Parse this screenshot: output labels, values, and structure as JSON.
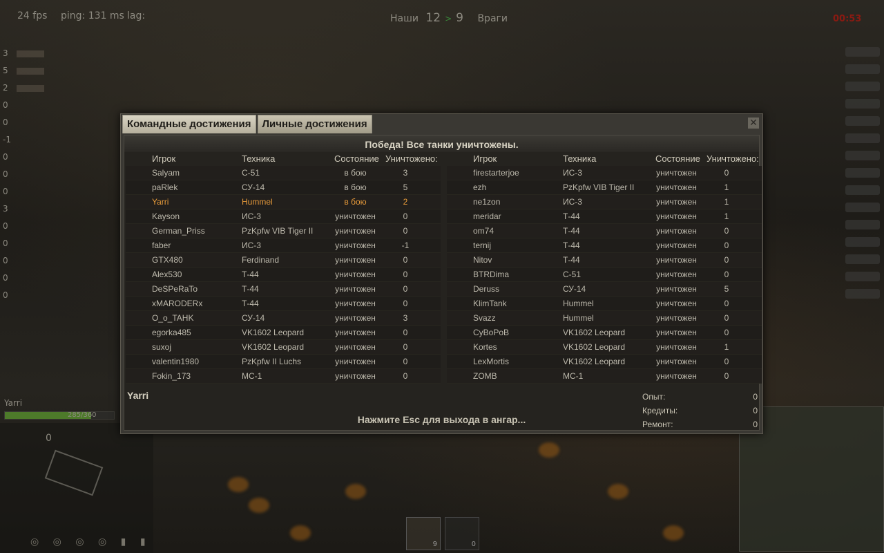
{
  "hud": {
    "fps": "24 fps",
    "ping": "ping: 131 ms",
    "lag": "lag:",
    "allies_label": "Наши",
    "allies_score": "12",
    "score_arrow": ">",
    "enemies_score": "9",
    "enemies_label": "Враги",
    "timer": "00:53",
    "left_frags": [
      "3",
      "5",
      "2",
      "0",
      "0",
      "-1",
      "0",
      "0",
      "0",
      "3",
      "0",
      "0",
      "0",
      "0",
      "0"
    ],
    "player_name": "Yarri",
    "hp_text": "285/360",
    "hp_fraction": 0.79,
    "speed": "0"
  },
  "dialog": {
    "tabs": [
      {
        "label": "Командные достижения",
        "active": true
      },
      {
        "label": "Личные достижения",
        "active": false
      }
    ],
    "close_icon": "close-icon",
    "result_text": "Победа! Все танки уничтожены.",
    "columns": {
      "player": "Игрок",
      "tank": "Техника",
      "status": "Состояние",
      "kills": "Уничтожено:"
    },
    "allies": [
      {
        "name": "Salyam",
        "tank": "С-51",
        "status": "в бою",
        "kills": "3"
      },
      {
        "name": "paRlek",
        "tank": "СУ-14",
        "status": "в бою",
        "kills": "5"
      },
      {
        "name": "Yarri",
        "tank": "Hummel",
        "status": "в бою",
        "kills": "2",
        "self": true
      },
      {
        "name": "Kayson",
        "tank": "ИС-3",
        "status": "уничтожен",
        "kills": "0"
      },
      {
        "name": "German_Priss",
        "tank": "PzKpfw VIB Tiger II",
        "status": "уничтожен",
        "kills": "0"
      },
      {
        "name": "faber",
        "tank": "ИС-3",
        "status": "уничтожен",
        "kills": "-1"
      },
      {
        "name": "GTX480",
        "tank": "Ferdinand",
        "status": "уничтожен",
        "kills": "0"
      },
      {
        "name": "Alex530",
        "tank": "Т-44",
        "status": "уничтожен",
        "kills": "0"
      },
      {
        "name": "DeSPeRaTo",
        "tank": "Т-44",
        "status": "уничтожен",
        "kills": "0"
      },
      {
        "name": "xMARODERx",
        "tank": "Т-44",
        "status": "уничтожен",
        "kills": "0"
      },
      {
        "name": "O_o_TAHK",
        "tank": "СУ-14",
        "status": "уничтожен",
        "kills": "3"
      },
      {
        "name": "egorka485",
        "tank": "VK1602 Leopard",
        "status": "уничтожен",
        "kills": "0"
      },
      {
        "name": "suxoj",
        "tank": "VK1602 Leopard",
        "status": "уничтожен",
        "kills": "0"
      },
      {
        "name": "valentin1980",
        "tank": "PzKpfw II Luchs",
        "status": "уничтожен",
        "kills": "0"
      },
      {
        "name": "Fokin_173",
        "tank": "МС-1",
        "status": "уничтожен",
        "kills": "0"
      }
    ],
    "enemies": [
      {
        "name": "firestarterjoe",
        "tank": "ИС-3",
        "status": "уничтожен",
        "kills": "0"
      },
      {
        "name": "ezh",
        "tank": "PzKpfw VIB Tiger II",
        "status": "уничтожен",
        "kills": "1"
      },
      {
        "name": "ne1zon",
        "tank": "ИС-3",
        "status": "уничтожен",
        "kills": "1"
      },
      {
        "name": "meridar",
        "tank": "Т-44",
        "status": "уничтожен",
        "kills": "1"
      },
      {
        "name": "om74",
        "tank": "Т-44",
        "status": "уничтожен",
        "kills": "0"
      },
      {
        "name": "ternij",
        "tank": "Т-44",
        "status": "уничтожен",
        "kills": "0"
      },
      {
        "name": "Nitov",
        "tank": "Т-44",
        "status": "уничтожен",
        "kills": "0"
      },
      {
        "name": "BTRDima",
        "tank": "С-51",
        "status": "уничтожен",
        "kills": "0"
      },
      {
        "name": "Deruss",
        "tank": "СУ-14",
        "status": "уничтожен",
        "kills": "5"
      },
      {
        "name": "KlimTank",
        "tank": "Hummel",
        "status": "уничтожен",
        "kills": "0"
      },
      {
        "name": "Svazz",
        "tank": "Hummel",
        "status": "уничтожен",
        "kills": "0"
      },
      {
        "name": "CyBoPoB",
        "tank": "VK1602 Leopard",
        "status": "уничтожен",
        "kills": "0"
      },
      {
        "name": "Kortes",
        "tank": "VK1602 Leopard",
        "status": "уничтожен",
        "kills": "1"
      },
      {
        "name": "LexMortis",
        "tank": "VK1602 Leopard",
        "status": "уничтожен",
        "kills": "0"
      },
      {
        "name": "ZOMB",
        "tank": "МС-1",
        "status": "уничтожен",
        "kills": "0"
      }
    ],
    "footer": {
      "player": "Yarri",
      "hint": "Нажмите Esc для выхода в ангар...",
      "stats": [
        {
          "label": "Опыт:",
          "value": "0"
        },
        {
          "label": "Кредиты:",
          "value": "0"
        },
        {
          "label": "Ремонт:",
          "value": "0"
        }
      ]
    }
  },
  "ammo": {
    "slot1_count": "9",
    "slot2_count": "0"
  }
}
